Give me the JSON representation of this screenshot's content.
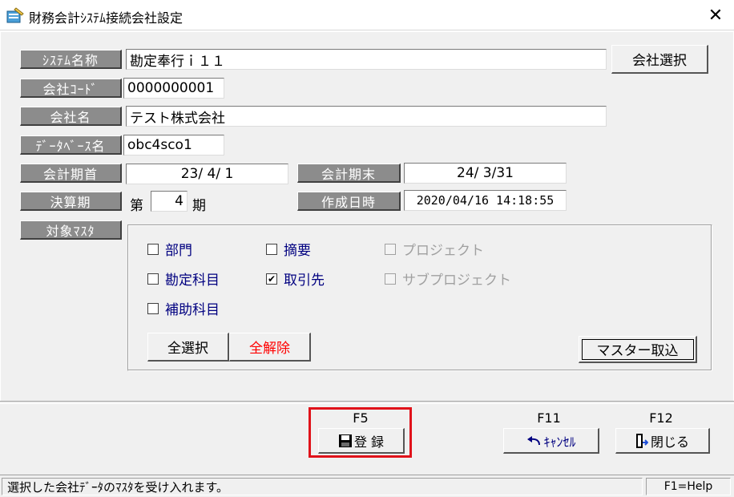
{
  "window": {
    "title": "財務会計ｼｽﾃﾑ接続会社設定",
    "close_glyph": "✕"
  },
  "fields": {
    "system_name": {
      "label": "ｼｽﾃﾑ名称",
      "value": "勘定奉行ｉ１１"
    },
    "company_code": {
      "label": "会社ｺｰﾄﾞ",
      "value": "0000000001"
    },
    "company_name": {
      "label": "会社名",
      "value": "テスト株式会社"
    },
    "database_name": {
      "label": "ﾃﾞｰﾀﾍﾞｰｽ名",
      "value": "obc4sco1"
    },
    "fiscal_start": {
      "label": "会計期首",
      "value": "23/ 4/ 1"
    },
    "fiscal_end": {
      "label": "会計期末",
      "value": "24/ 3/31"
    },
    "closing_period": {
      "label": "決算期",
      "prefix": "第",
      "value": "4",
      "suffix": "期"
    },
    "created_at": {
      "label": "作成日時",
      "value": "2020/04/16 14:18:55"
    },
    "target_master": {
      "label": "対象ﾏｽﾀ"
    }
  },
  "buttons": {
    "company_select": "会社選択",
    "select_all": "全選択",
    "deselect_all": "全解除",
    "master_import": "マスター取込"
  },
  "checkboxes": [
    {
      "label": "部門",
      "checked": false,
      "enabled": true
    },
    {
      "label": "摘要",
      "checked": false,
      "enabled": true
    },
    {
      "label": "プロジェクト",
      "checked": false,
      "enabled": false
    },
    {
      "label": "勘定科目",
      "checked": false,
      "enabled": true
    },
    {
      "label": "取引先",
      "checked": true,
      "enabled": true
    },
    {
      "label": "サブプロジェクト",
      "checked": false,
      "enabled": false
    },
    {
      "label": "補助科目",
      "checked": false,
      "enabled": true
    }
  ],
  "function_keys": {
    "register": {
      "key": "F5",
      "label": "登 録",
      "icon": "floppy-disk-icon"
    },
    "cancel": {
      "key": "F11",
      "label": "ｷｬﾝｾﾙ",
      "icon": "undo-arrow-icon"
    },
    "close": {
      "key": "F12",
      "label": "閉じる",
      "icon": "exit-door-icon"
    }
  },
  "status": {
    "message": "選択した会社ﾃﾞｰﾀのﾏｽﾀを受け入れます。",
    "help": "F1=Help"
  },
  "colors": {
    "highlight": "#e0121a",
    "label_bg": "#8c8c8c",
    "checkbox_text": "#000080",
    "deselect_text": "#ff0000"
  }
}
